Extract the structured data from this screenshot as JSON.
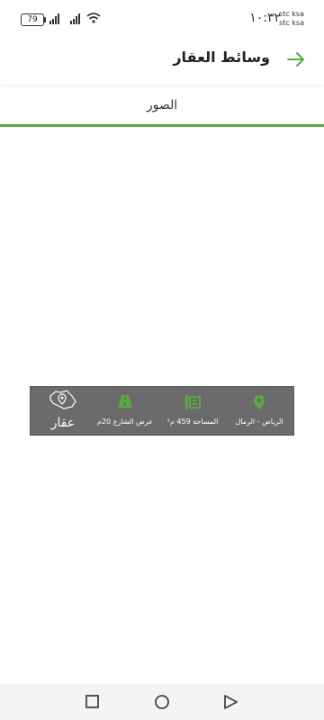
{
  "status_bar": {
    "battery": "79",
    "time": "١٠:٣٢",
    "carrier_1": "stc ksa",
    "carrier_2": "stc ksa"
  },
  "header": {
    "title": "وسائط العقار",
    "back_icon": "arrow-right-icon",
    "accent_color": "#5aa844"
  },
  "tabs": [
    {
      "label": "الصور",
      "active": true
    }
  ],
  "info_card": {
    "location_label": "الرياض - الرمال",
    "area_label": "المساحة 459 م²",
    "street_label": "عرض الشارع 20م",
    "logo_text": "عقار",
    "icons": [
      "location-pin-icon",
      "area-icon",
      "road-icon",
      "aqar-logo-icon"
    ]
  },
  "nav": {
    "buttons": [
      "recent-apps-icon",
      "home-icon",
      "back-icon"
    ]
  }
}
